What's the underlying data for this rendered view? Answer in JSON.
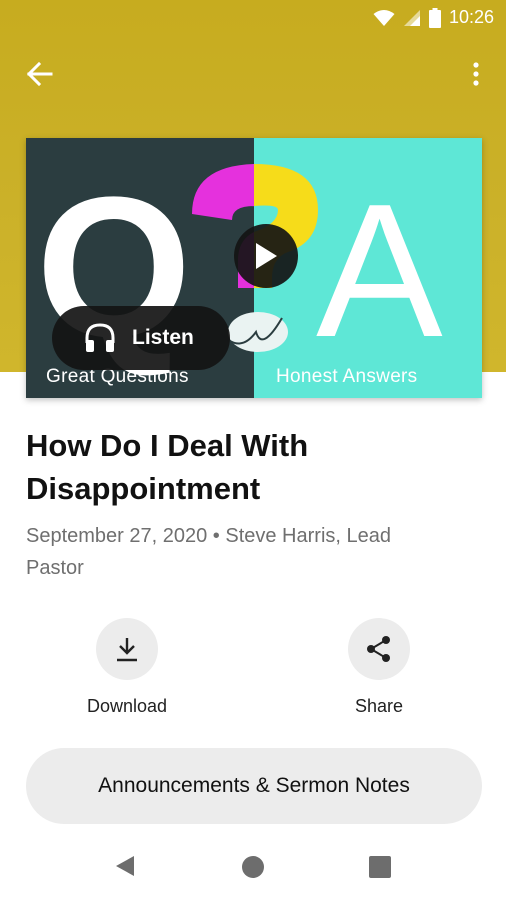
{
  "status_bar": {
    "time": "10:26"
  },
  "colors": {
    "header": "#cbb129",
    "art_dark": "#2b3d40",
    "art_teal": "#5ee7d6",
    "qmark_magenta": "#e531dd",
    "qmark_yellow": "#f6dc1a"
  },
  "icons": {
    "back": "arrow-left",
    "more": "dots-vertical",
    "play": "play",
    "listen": "headphones",
    "download": "download",
    "share": "share"
  },
  "artwork": {
    "letter_left": "Q",
    "letter_right": "A",
    "caption_left": "Great Questions",
    "caption_right": "Honest Answers"
  },
  "player": {
    "listen_label": "Listen"
  },
  "sermon": {
    "title": "How Do I Deal With Disappointment",
    "meta": "September 27, 2020 • Steve Harris, Lead Pastor"
  },
  "actions": {
    "download_label": "Download",
    "share_label": "Share"
  },
  "notes_button": "Announcements & Sermon Notes"
}
